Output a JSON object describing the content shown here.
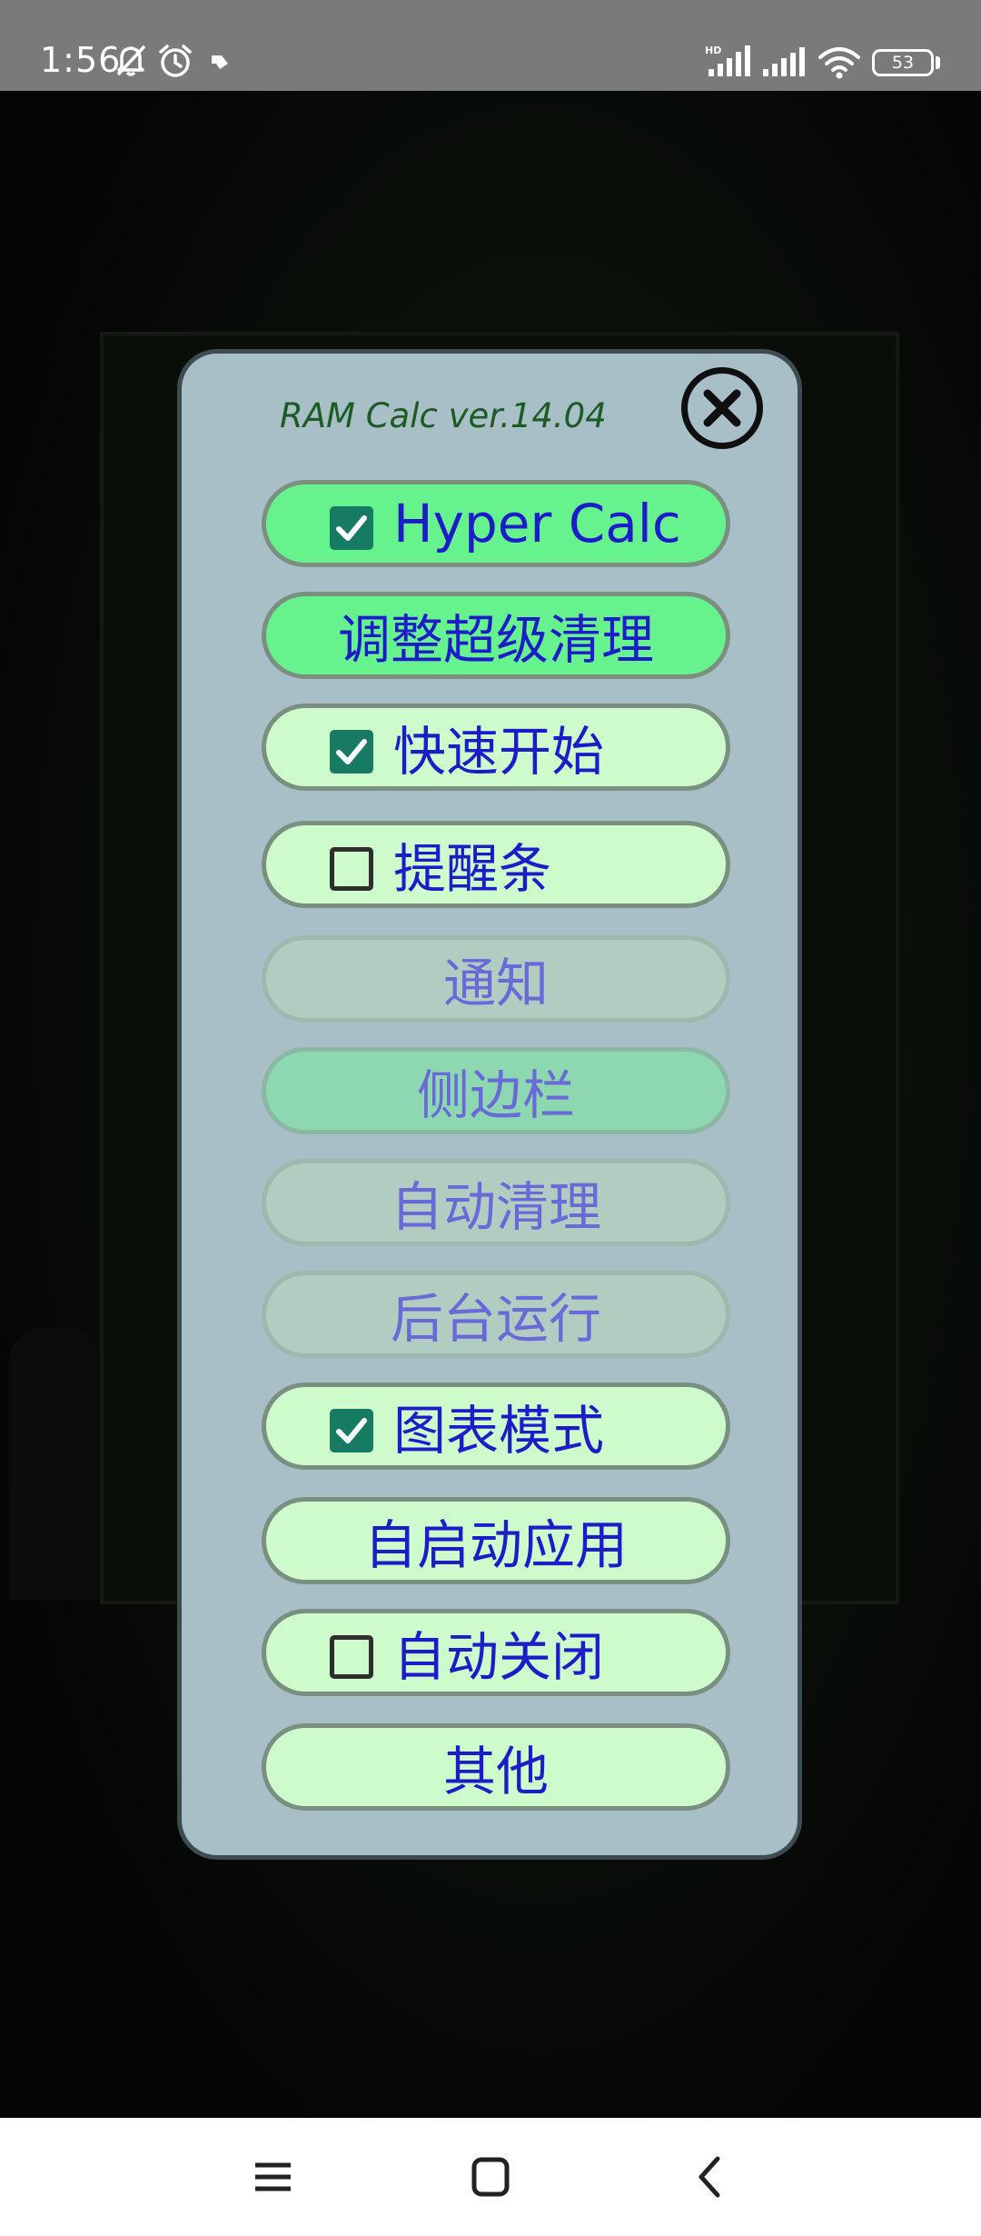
{
  "status_bar": {
    "time": "1:56",
    "icons": [
      "bell-off-icon",
      "alarm-icon",
      "notification-icon",
      "hd-signal-icon",
      "signal-icon",
      "wifi-icon"
    ],
    "battery": "53"
  },
  "dialog": {
    "title": "RAM Calc ver.14.04",
    "close_icon": "close-icon",
    "buttons": [
      {
        "label": "Hyper Calc",
        "checkbox": "checked",
        "state": "active"
      },
      {
        "label": "调整超级清理",
        "checkbox": "none",
        "state": "active"
      },
      {
        "label": "快速开始",
        "checkbox": "checked",
        "state": "normal"
      },
      {
        "label": "提醒条",
        "checkbox": "unchecked",
        "state": "normal"
      },
      {
        "label": "通知",
        "checkbox": "none",
        "state": "disabled"
      },
      {
        "label": "侧边栏",
        "checkbox": "none",
        "state": "disabled-green"
      },
      {
        "label": "自动清理",
        "checkbox": "none",
        "state": "disabled"
      },
      {
        "label": "后台运行",
        "checkbox": "none",
        "state": "disabled"
      },
      {
        "label": "图表模式",
        "checkbox": "checked",
        "state": "normal"
      },
      {
        "label": "自启动应用",
        "checkbox": "none",
        "state": "normal"
      },
      {
        "label": "自动关闭",
        "checkbox": "unchecked",
        "state": "normal"
      },
      {
        "label": "其他",
        "checkbox": "none",
        "state": "normal"
      }
    ]
  },
  "nav_bar": {
    "items": [
      "menu-icon",
      "home-icon",
      "back-icon"
    ]
  },
  "colors": {
    "dialog_bg": "#a8bfc7",
    "button_active": "#66f38e",
    "button_normal": "#cdfbcc",
    "button_text": "#1c1cc8",
    "checkbox_checked": "#177a63",
    "title_text": "#1a5c24"
  }
}
